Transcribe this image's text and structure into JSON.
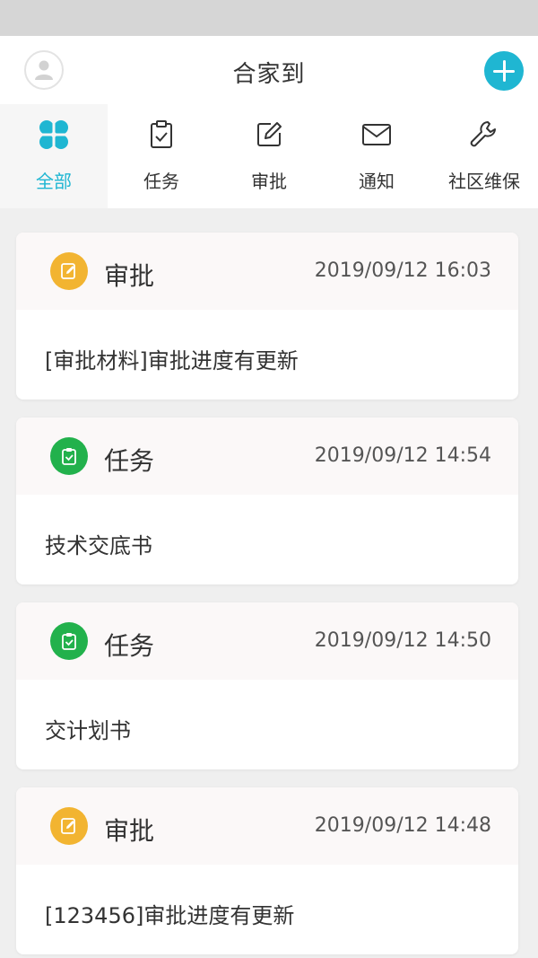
{
  "header": {
    "title": "合家到",
    "avatar_icon": "user-icon",
    "add_icon": "plus-icon",
    "accent_color": "#1fb6d2"
  },
  "tabs": [
    {
      "label": "全部",
      "icon": "grid-icon",
      "active": true
    },
    {
      "label": "任务",
      "icon": "clipboard-check-icon",
      "active": false
    },
    {
      "label": "审批",
      "icon": "edit-icon",
      "active": false
    },
    {
      "label": "通知",
      "icon": "mail-icon",
      "active": false
    },
    {
      "label": "社区维保",
      "icon": "wrench-icon",
      "active": false
    }
  ],
  "cards": [
    {
      "type": "审批",
      "type_color": "#f2b431",
      "icon": "edit-icon",
      "timestamp": "2019/09/12 16:03",
      "message": "[审批材料]审批进度有更新"
    },
    {
      "type": "任务",
      "type_color": "#22b14c",
      "icon": "clipboard-check-icon",
      "timestamp": "2019/09/12 14:54",
      "message": "技术交底书"
    },
    {
      "type": "任务",
      "type_color": "#22b14c",
      "icon": "clipboard-check-icon",
      "timestamp": "2019/09/12 14:50",
      "message": "交计划书"
    },
    {
      "type": "审批",
      "type_color": "#f2b431",
      "icon": "edit-icon",
      "timestamp": "2019/09/12 14:48",
      "message": "[123456]审批进度有更新"
    }
  ]
}
